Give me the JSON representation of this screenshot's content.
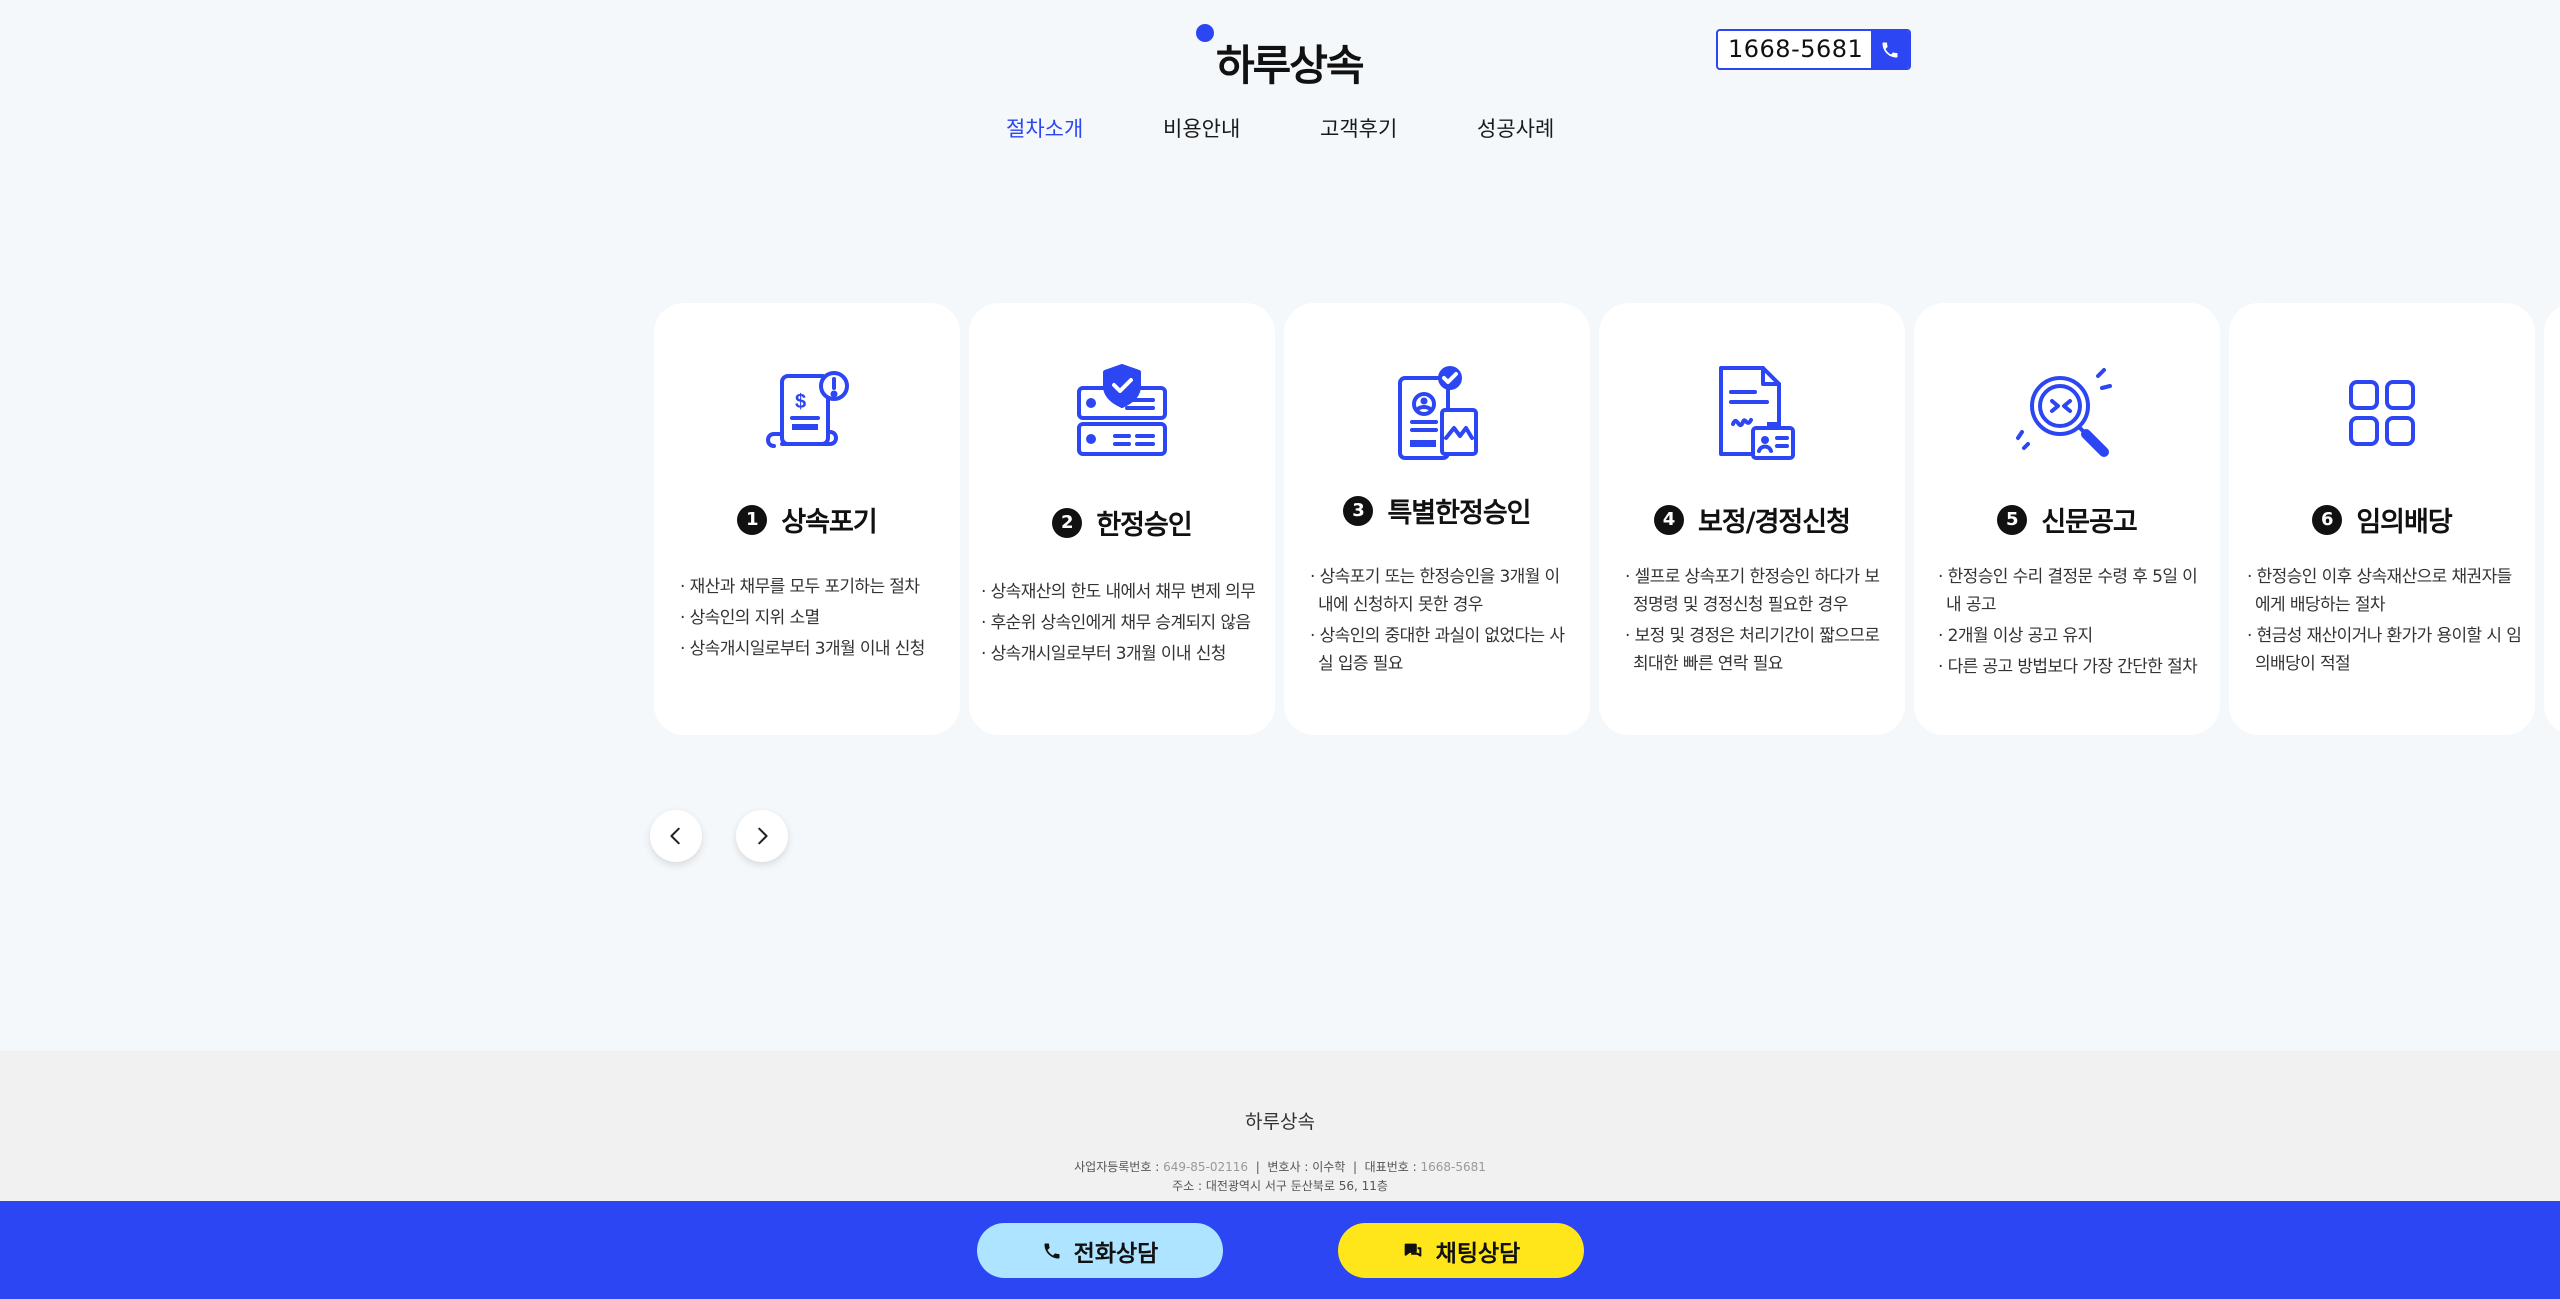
{
  "header": {
    "logo_text": "하루상속",
    "phone_number": "1668-5681"
  },
  "nav": {
    "items": [
      {
        "label": "절차소개",
        "active": true
      },
      {
        "label": "비용안내",
        "active": false
      },
      {
        "label": "고객후기",
        "active": false
      },
      {
        "label": "성공사례",
        "active": false
      }
    ]
  },
  "steps": [
    {
      "num": "1",
      "title": "상속포기",
      "icon": "inheritance-document-icon",
      "lines": [
        "· 재산과 채무를 모두 포기하는 절차",
        "· 상속인의 지위 소멸",
        "· 상속개시일로부터 3개월 이내 신청"
      ]
    },
    {
      "num": "2",
      "title": "한정승인",
      "icon": "shield-check-server-icon",
      "lines": [
        "· 상속재산의 한도 내에서 채무 변제 의무",
        "· 후순위 상속인에게 채무 승계되지 않음",
        "· 상속개시일로부터 3개월 이내 신청"
      ]
    },
    {
      "num": "3",
      "title": "특별한정승인",
      "icon": "verified-id-card-icon",
      "lines": [
        "· 상속포기 또는 한정승인을 3개월 이내에 신청하지 못한 경우",
        "· 상속인의 중대한 과실이 없었다는 사실 입증 필요"
      ]
    },
    {
      "num": "4",
      "title": "보정/경정신청",
      "icon": "signed-document-icon",
      "lines": [
        "· 셀프로 상속포기 한정승인 하다가 보정명령 및 경정신청 필요한 경우",
        "· 보정 및 경정은 처리기간이 짧으므로 최대한 빠른 연락 필요"
      ]
    },
    {
      "num": "5",
      "title": "신문공고",
      "icon": "magnifier-search-icon",
      "lines": [
        "· 한정승인 수리 결정문 수령 후 5일 이내 공고",
        "· 2개월 이상 공고 유지",
        "· 다른 공고 방법보다 가장 간단한 절차"
      ]
    },
    {
      "num": "6",
      "title": "임의배당",
      "icon": "grid-apps-icon",
      "lines": [
        "· 한정승인 이후 상속재산으로 채권자들에게 배당하는 절차",
        "· 현금성 재산이거나 환가가 용이할 시 임의배당이 적절"
      ]
    }
  ],
  "footer": {
    "company": "하루상속",
    "biz_label": "사업자등록번호 : ",
    "biz_no": "649-85-02116",
    "lawyer_label": "변호사 : ",
    "lawyer": "이수학",
    "rep_label": "대표번호 : ",
    "rep_no": "1668-5681",
    "address": "주소 : 대전광역시 서구 둔산북로 56, 11층"
  },
  "bottom_bar": {
    "phone_cta": "전화상담",
    "chat_cta": "채팅상담"
  },
  "colors": {
    "accent": "#2b46f2",
    "phone_cta_bg": "#aee4ff",
    "chat_cta_bg": "#ffe61a"
  }
}
